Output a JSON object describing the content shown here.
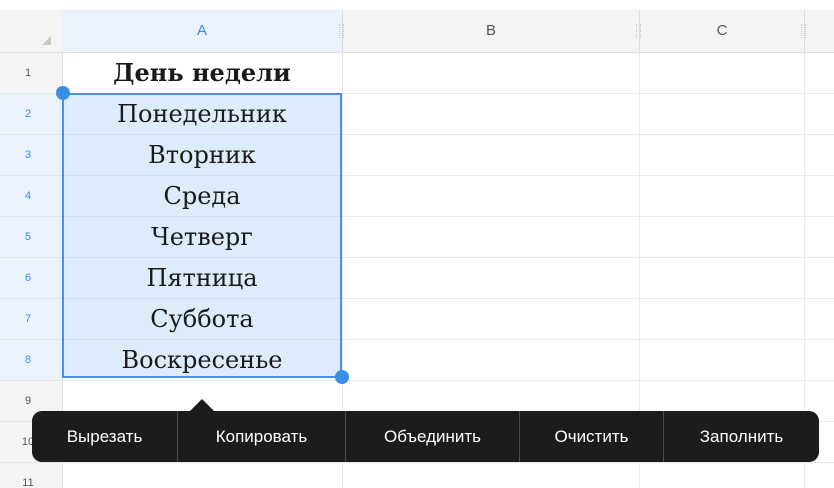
{
  "columns": [
    "A",
    "B",
    "C"
  ],
  "rows": [
    "1",
    "2",
    "3",
    "4",
    "5",
    "6",
    "7",
    "8",
    "9",
    "10",
    "11"
  ],
  "cells": {
    "a1": "День недели",
    "a2": "Понедельник",
    "a3": "Вторник",
    "a4": "Среда",
    "a5": "Четверг",
    "a6": "Пятница",
    "a7": "Суббота",
    "a8": "Воскресенье"
  },
  "selection": {
    "range": "A2:A8",
    "color": "#4a90e2"
  },
  "menu": {
    "cut": "Вырезать",
    "copy": "Копировать",
    "merge": "Объединить",
    "clear": "Очистить",
    "fill": "Заполнить"
  },
  "colors": {
    "accent": "#3a8ee6",
    "menu_bg": "#1c1c1e",
    "header_bg": "#f4f4f4"
  }
}
